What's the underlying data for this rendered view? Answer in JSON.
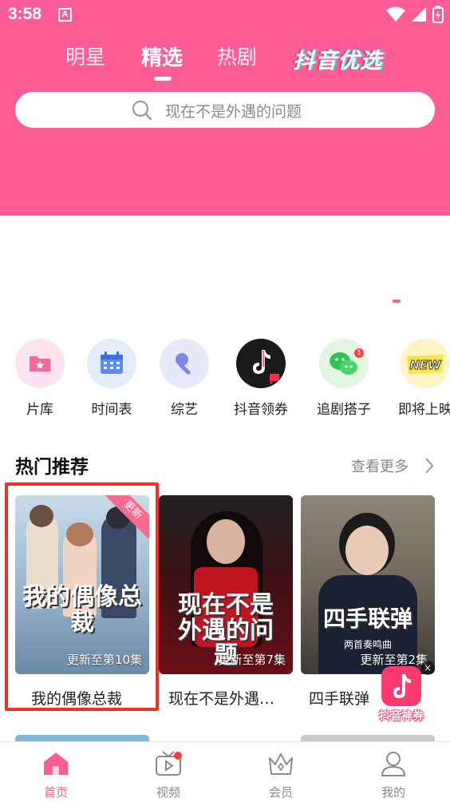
{
  "status_bar": {
    "time": "3:58",
    "notification_letter": "A"
  },
  "header": {
    "tabs": [
      {
        "label": "明星"
      },
      {
        "label": "精选",
        "active": true
      },
      {
        "label": "热剧"
      }
    ],
    "brand_tab": "抖音优选",
    "background_color": "#fd5c94"
  },
  "search": {
    "placeholder": "现在不是外遇的问题"
  },
  "shortcuts": [
    {
      "label": "片库",
      "icon": "folder-star-icon"
    },
    {
      "label": "时间表",
      "icon": "calendar-icon"
    },
    {
      "label": "综艺",
      "icon": "microphone-icon"
    },
    {
      "label": "抖音领券",
      "icon": "douyin-cart-icon"
    },
    {
      "label": "追剧搭子",
      "icon": "wechat-icon",
      "badge": "1"
    },
    {
      "label": "即将上映",
      "icon": "new-badge-icon"
    }
  ],
  "section": {
    "title": "热门推荐",
    "more_label": "查看更多"
  },
  "cards": [
    {
      "title": "我的偶像总裁",
      "poster_text": "我的偶像总裁",
      "episode": "更新至第10集",
      "badge": "更新"
    },
    {
      "title": "现在不是外遇…",
      "poster_text": "现在不是外遇的问题",
      "episode": "更新至第7集"
    },
    {
      "title": "四手联弹",
      "poster_text": "四手联弹",
      "poster_subtext": "两首奏鸣曲",
      "episode": "更新至第2集"
    }
  ],
  "floating_coupon": {
    "label": "抖音神券",
    "close": "×"
  },
  "bottom_nav": [
    {
      "label": "首页",
      "icon": "home-icon",
      "active": true
    },
    {
      "label": "视频",
      "icon": "tv-icon",
      "dot": true
    },
    {
      "label": "会员",
      "icon": "crown-icon"
    },
    {
      "label": "我的",
      "icon": "user-icon"
    }
  ],
  "accent_color": "#fd5c94"
}
